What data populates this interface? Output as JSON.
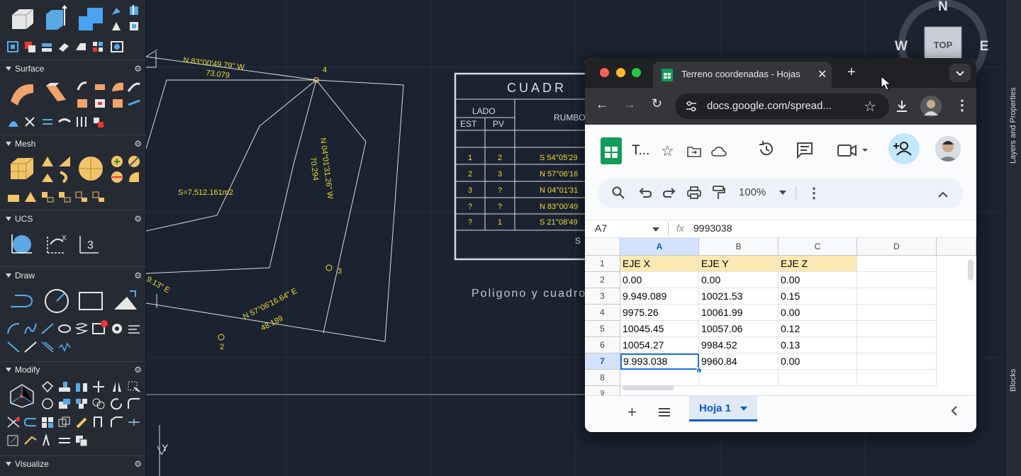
{
  "cad": {
    "palette_sections": [
      {
        "label": "Surface"
      },
      {
        "label": "Mesh"
      },
      {
        "label": "UCS"
      },
      {
        "label": "Draw"
      },
      {
        "label": "Modify"
      },
      {
        "label": "Visualize"
      }
    ],
    "viewcube": {
      "north": "N",
      "west": "W",
      "east": "E",
      "face": "TOP"
    },
    "side_panels": {
      "layers": "Layers and Properties",
      "blocks": "Blocks"
    },
    "drawing_text": {
      "side_1_bearing": "N 83°00'49.79\" W",
      "side_1_length": "73.079",
      "side_2_bearing": "N 04°01'31.26\" W",
      "side_2_length": "70.294",
      "side_3_bearing": "N 57°06'16.64\" E",
      "side_3_length": "48.189",
      "side_4_partial": "9.13\" E",
      "area": "S=7,512.161m2",
      "point_4": "4",
      "point_3": "3",
      "point_2": "2",
      "caption": "Poligono y cuadro",
      "ucs_y": "Y"
    },
    "table": {
      "title": "CUADR",
      "lado": "LADO",
      "est": "EST",
      "pv": "PV",
      "rumbo": "RUMBO",
      "rows": [
        {
          "est": "1",
          "pv": "2",
          "rumbo": "S 54°05'29"
        },
        {
          "est": "2",
          "pv": "3",
          "rumbo": "N 57°06'16"
        },
        {
          "est": "3",
          "pv": "?",
          "rumbo": "N 04°01'31"
        },
        {
          "est": "?",
          "pv": "?",
          "rumbo": "N 83°00'49"
        },
        {
          "est": "?",
          "pv": "1",
          "rumbo": "S 21°08'49"
        }
      ],
      "footer_partial": "S"
    }
  },
  "browser": {
    "tab_title": "Terreno coordenadas - Hojas",
    "url": "docs.google.com/spread...",
    "doc_title": "T...",
    "zoom": "100%",
    "cell_ref": "A7",
    "formula_value": "9993038",
    "sheet_tab": "Hoja 1",
    "columns": [
      "A",
      "B",
      "C",
      "D"
    ],
    "rows": [
      {
        "n": "1",
        "a": "EJE X",
        "b": "EJE Y",
        "c": "EJE Z"
      },
      {
        "n": "2",
        "a": "0.00",
        "b": "0.00",
        "c": "0.00"
      },
      {
        "n": "3",
        "a": "9.949.089",
        "b": "10021.53",
        "c": "0.15"
      },
      {
        "n": "4",
        "a": "9975.26",
        "b": "10061.99",
        "c": "0.00"
      },
      {
        "n": "5",
        "a": "10045.45",
        "b": "10057.06",
        "c": "0.12"
      },
      {
        "n": "6",
        "a": "10054.27",
        "b": "9984.52",
        "c": "0.13"
      },
      {
        "n": "7",
        "a": "9.993.038",
        "b": "9960.84",
        "c": "0.00"
      },
      {
        "n": "8",
        "a": "",
        "b": "",
        "c": ""
      },
      {
        "n": "9",
        "a": "",
        "b": "",
        "c": ""
      }
    ],
    "colors": {
      "header_fill": "#fce8b2",
      "selection": "#1a73e8",
      "sheets_green": "#0f9d58"
    }
  }
}
